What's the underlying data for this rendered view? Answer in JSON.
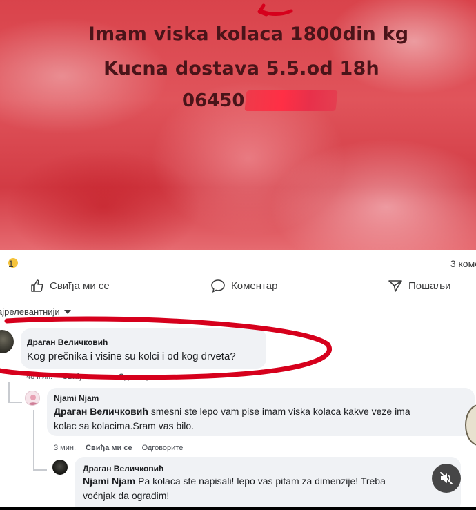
{
  "post": {
    "line1": "Imam viska kolaca 1800din kg",
    "line2": "Kucna dostava 5.5.od 18h",
    "phone_visible": "06450"
  },
  "stats": {
    "reactions": "1",
    "comments": "3 коме"
  },
  "actions": {
    "like": "Свиђа ми се",
    "comment": "Коментар",
    "share": "Пошаљи"
  },
  "sort": {
    "label": "ајрелевантнији"
  },
  "comments": [
    {
      "author": "Драган Величковић",
      "text": "Kog prečnika i visine su kolci i od kog drveta?",
      "time": "48 мин.",
      "like": "Свиђа ми се",
      "reply": "Одговорите"
    },
    {
      "author": "Njami Njam",
      "mention": "Драган Величковић",
      "text": "smesni ste lepo vam pise imam viska kolaca kakve veze ima",
      "text2": "kolac sa kolacima.Sram vas bilo.",
      "time": "3 мин.",
      "like": "Свиђа ми се",
      "reply": "Одговорите"
    },
    {
      "author": "Драган Величковић",
      "mention": "Njami Njam",
      "text": "Pa kolaca ste napisali! lepo vas pitam za dimenzije! Treba",
      "text2": "voćnjak da ogradim!"
    }
  ],
  "colors": {
    "annotation_red": "#d6001c",
    "bubble_bg": "#f0f2f5"
  }
}
